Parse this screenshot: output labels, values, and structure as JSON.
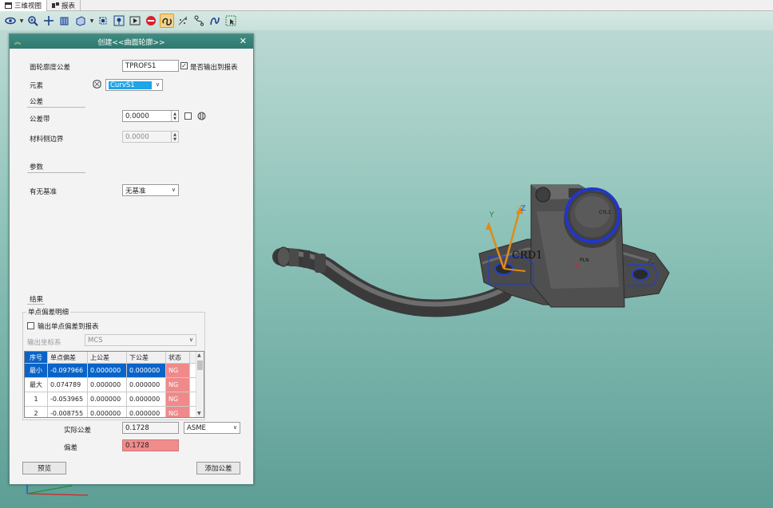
{
  "tabs": [
    {
      "label": "三维视图",
      "active": true
    },
    {
      "label": "报表",
      "active": false
    }
  ],
  "toolbar": {
    "icons": [
      "eye-icon",
      "zoom-icon",
      "pan-icon",
      "view-cube-icon",
      "box-view-icon",
      "fit-icon",
      "marker-icon",
      "play-icon",
      "stop-icon",
      "link-icon",
      "scatter-icon",
      "path-icon",
      "curve-icon",
      "select-box-icon"
    ],
    "active_icon": "link-icon"
  },
  "dialog": {
    "title": "创建<<曲面轮廓>>",
    "name_label": "面轮廓度公差",
    "name_value": "TPROFS1",
    "output_report_label": "是否输出到报表",
    "element_label": "元素",
    "element_value": "CurvS1",
    "tolerance_section": "公差",
    "tol_band_label": "公差带",
    "tol_band_value": "0.0000",
    "material_label": "材料侧边界",
    "material_value": "0.0000",
    "params_section": "参数",
    "datum_label": "有无基准",
    "datum_value": "无基准",
    "results_section": "结果",
    "point_dev_group": "单点偏差明细",
    "output_point_label": "输出单点偏差到报表",
    "output_cs_label": "输出坐标系",
    "output_cs_value": "MCS",
    "table": {
      "headers": [
        "序号",
        "单点偏差",
        "上公差",
        "下公差",
        "状态"
      ],
      "rows": [
        [
          "最小",
          "-0.097966",
          "0.000000",
          "0.000000",
          "NG"
        ],
        [
          "最大",
          "0.074789",
          "0.000000",
          "0.000000",
          "NG"
        ],
        [
          "1",
          "-0.053965",
          "0.000000",
          "0.000000",
          "NG"
        ],
        [
          "2",
          "-0.008755",
          "0.000000",
          "0.000000",
          "NG"
        ]
      ]
    },
    "actual_tol_label": "实际公差",
    "actual_tol_value": "0.1728",
    "standard_value": "ASME",
    "deviation_label": "偏差",
    "deviation_value": "0.1728",
    "preview_button": "预览",
    "add_button": "添加公差"
  },
  "viewport": {
    "labels": {
      "crd": "CRD1",
      "cyl": "CYL1",
      "pln": "PLN",
      "pl": "PL",
      "y_axis": "Y",
      "z_axis": "Z"
    }
  },
  "colors": {
    "title_bar": "#2f7a70",
    "selection": "#0a64c8",
    "ng_fill": "#f08a8a",
    "feature_blue": "#1f3fd0",
    "axis_orange": "#e08a1a"
  }
}
